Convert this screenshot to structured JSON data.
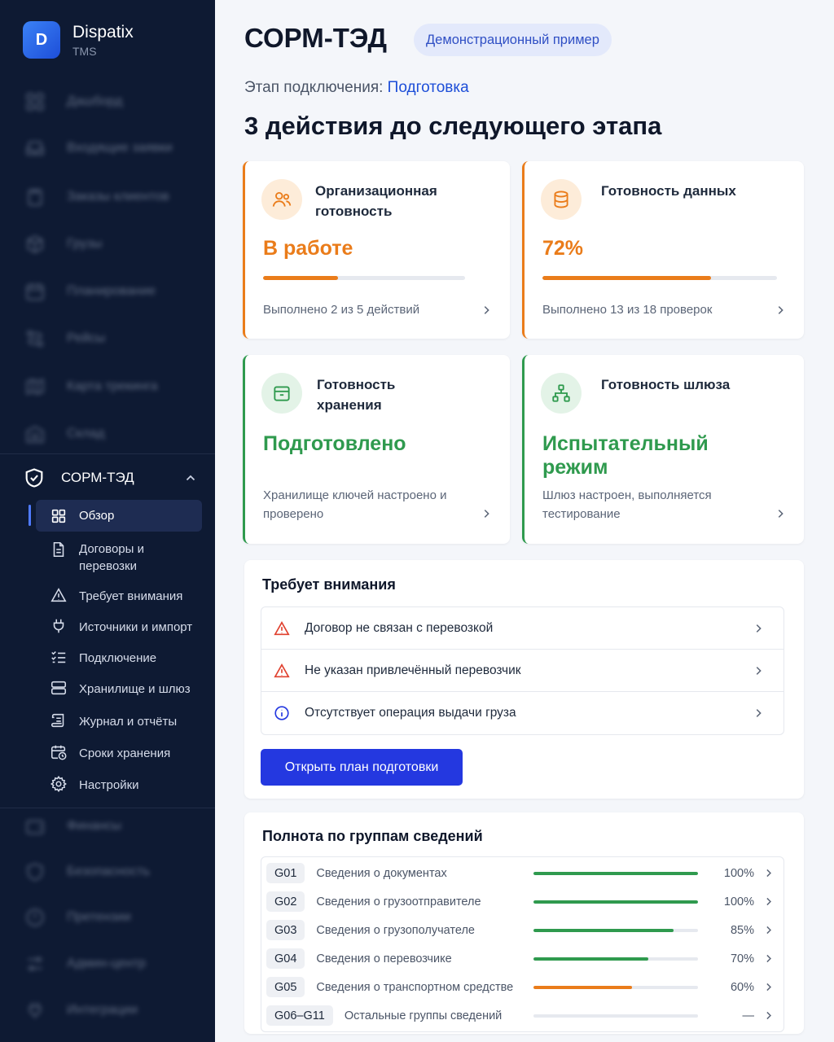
{
  "brand": {
    "logo_letter": "D",
    "name": "Dispatix",
    "sub": "TMS"
  },
  "sidebar": {
    "blurred_items": [
      {
        "label": "Дашборд",
        "icon": "grid-icon"
      },
      {
        "label": "Входящие заявки",
        "icon": "inbox-icon"
      },
      {
        "label": "Заказы клиентов",
        "icon": "clipboard-icon"
      },
      {
        "label": "Грузы",
        "icon": "box-icon"
      },
      {
        "label": "Планирование",
        "icon": "calendar-icon"
      },
      {
        "label": "Рейсы",
        "icon": "route-icon"
      },
      {
        "label": "Карта трекинга",
        "icon": "map-icon"
      },
      {
        "label": "Склад",
        "icon": "warehouse-icon"
      },
      {
        "label": "Финансы",
        "icon": "wallet-icon"
      },
      {
        "label": "Безопасность",
        "icon": "shield-icon"
      },
      {
        "label": "Претензии",
        "icon": "alert-circle-icon"
      },
      {
        "label": "Админ-центр",
        "icon": "sliders-icon"
      },
      {
        "label": "Интеграции",
        "icon": "plug-icon"
      }
    ],
    "section": {
      "label": "СОРМ-ТЭД",
      "icon": "shield-check-icon",
      "expanded": true
    },
    "sub_items": [
      {
        "label": "Обзор",
        "icon": "grid-icon",
        "active": true
      },
      {
        "label": "Договоры и перевозки",
        "icon": "document-icon",
        "active": false
      },
      {
        "label": "Требует внимания",
        "icon": "warning-icon",
        "active": false
      },
      {
        "label": "Источники и импорт",
        "icon": "plug-icon",
        "active": false
      },
      {
        "label": "Подключение",
        "icon": "checklist-icon",
        "active": false
      },
      {
        "label": "Хранилище и шлюз",
        "icon": "server-icon",
        "active": false
      },
      {
        "label": "Журнал и отчёты",
        "icon": "scroll-icon",
        "active": false
      },
      {
        "label": "Сроки хранения",
        "icon": "calendar-clock-icon",
        "active": false
      },
      {
        "label": "Настройки",
        "icon": "gear-icon",
        "active": false
      }
    ]
  },
  "header": {
    "title": "СОРМ-ТЭД",
    "badge": "Демонстрационный пример",
    "stage_label": "Этап подключения:",
    "stage_value": "Подготовка",
    "steps_title": "3 действия до следующего этапа"
  },
  "cards": [
    {
      "title": "Организационная готовность",
      "status": "В работе",
      "progress": 0.37,
      "footer": "Выполнено 2 из 5 действий",
      "tone": "orange",
      "icon": "users-icon"
    },
    {
      "title": "Готовность данных",
      "status": "72%",
      "progress": 0.72,
      "footer": "Выполнено 13 из 18 проверок",
      "tone": "orange",
      "icon": "database-icon"
    },
    {
      "title": "Готовность хранения",
      "status": "Подготовлено",
      "footer": "Хранилище ключей настроено и проверено",
      "tone": "green",
      "icon": "archive-icon"
    },
    {
      "title": "Готовность шлюза",
      "status": "Испытательный режим",
      "footer": "Шлюз настроен, выполняется тестирование",
      "tone": "green",
      "icon": "network-icon"
    }
  ],
  "attention": {
    "title": "Требует внимания",
    "items": [
      {
        "text": "Договор не связан с перевозкой",
        "type": "warning"
      },
      {
        "text": "Не указан привлечённый перевозчик",
        "type": "warning"
      },
      {
        "text": "Отсутствует операция выдачи груза",
        "type": "info"
      }
    ],
    "button": "Открыть план подготовки"
  },
  "groups": {
    "title": "Полнота по группам сведений",
    "rows": [
      {
        "code": "G01",
        "name": "Сведения о документах",
        "pct_text": "100%",
        "value": 100,
        "color": "#2f9a4e"
      },
      {
        "code": "G02",
        "name": "Сведения о грузоотправителе",
        "pct_text": "100%",
        "value": 100,
        "color": "#2f9a4e"
      },
      {
        "code": "G03",
        "name": "Сведения о грузополучателе",
        "pct_text": "85%",
        "value": 85,
        "color": "#2f9a4e"
      },
      {
        "code": "G04",
        "name": "Сведения о перевозчике",
        "pct_text": "70%",
        "value": 70,
        "color": "#2f9a4e"
      },
      {
        "code": "G05",
        "name": "Сведения о транспортном средстве",
        "pct_text": "60%",
        "value": 60,
        "color": "#ea7c1a"
      },
      {
        "code": "G06–G11",
        "name": "Остальные группы сведений",
        "pct_text": "—",
        "value": 0,
        "color": "#c9ced8"
      }
    ]
  },
  "colors": {
    "sidebar_bg": "#0e1a33",
    "accent_blue": "#2438e0",
    "orange": "#ea7c1a",
    "green": "#2f9a4e",
    "warning_red": "#e0412f"
  }
}
